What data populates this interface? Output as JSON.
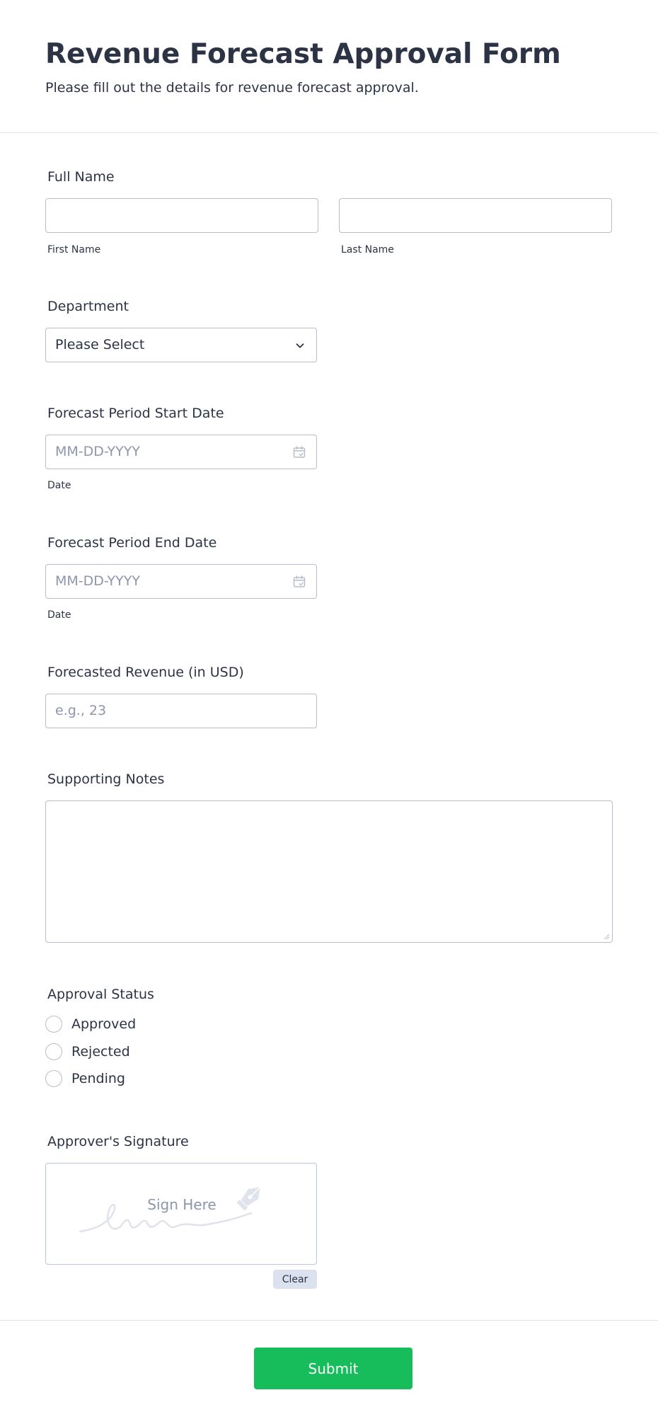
{
  "header": {
    "title": "Revenue Forecast Approval Form",
    "subtitle": "Please fill out the details for revenue forecast approval."
  },
  "full_name": {
    "label": "Full Name",
    "first_sublabel": "First Name",
    "last_sublabel": "Last Name",
    "first_value": "",
    "last_value": ""
  },
  "department": {
    "label": "Department",
    "selected": "Please Select",
    "icon": "chevron-down-icon"
  },
  "start_date": {
    "label": "Forecast Period Start Date",
    "placeholder": "MM-DD-YYYY",
    "sublabel": "Date",
    "icon": "calendar-icon"
  },
  "end_date": {
    "label": "Forecast Period End Date",
    "placeholder": "MM-DD-YYYY",
    "sublabel": "Date",
    "icon": "calendar-icon"
  },
  "revenue": {
    "label": "Forecasted Revenue (in USD)",
    "placeholder": "e.g., 23"
  },
  "notes": {
    "label": "Supporting Notes",
    "value": ""
  },
  "approval": {
    "label": "Approval Status",
    "options": [
      "Approved",
      "Rejected",
      "Pending"
    ]
  },
  "signature": {
    "label": "Approver's Signature",
    "prompt": "Sign Here",
    "clear_label": "Clear",
    "icon": "pen-nib-icon"
  },
  "submit_label": "Submit",
  "colors": {
    "text": "#2c3345",
    "placeholder": "#8d96ab",
    "border": "#b8bdc9",
    "submit": "#18bd5b",
    "clear_bg": "#dbe1ee"
  }
}
